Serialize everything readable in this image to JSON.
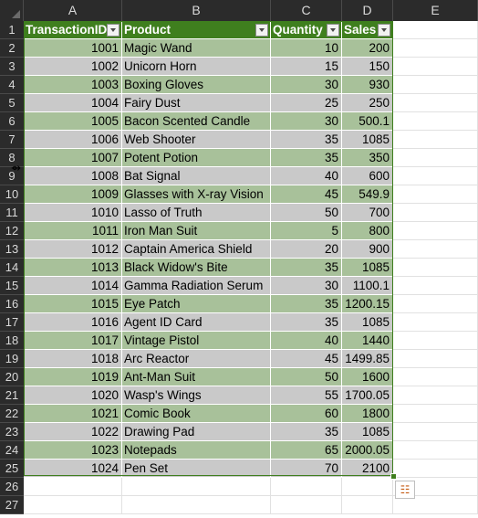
{
  "columns": [
    "A",
    "B",
    "C",
    "D",
    "E"
  ],
  "row_numbers": [
    "1",
    "2",
    "3",
    "4",
    "5",
    "6",
    "7",
    "8",
    "9",
    "10",
    "11",
    "12",
    "13",
    "14",
    "15",
    "16",
    "17",
    "18",
    "19",
    "20",
    "21",
    "22",
    "23",
    "24",
    "25",
    "26",
    "27"
  ],
  "table": {
    "headers": [
      "TransactionID",
      "Product",
      "Quantity",
      "Sales"
    ],
    "rows": [
      [
        "1001",
        "Magic Wand",
        "10",
        "200"
      ],
      [
        "1002",
        "Unicorn Horn",
        "15",
        "150"
      ],
      [
        "1003",
        "Boxing Gloves",
        "30",
        "930"
      ],
      [
        "1004",
        "Fairy Dust",
        "25",
        "250"
      ],
      [
        "1005",
        "Bacon Scented Candle",
        "30",
        "500.1"
      ],
      [
        "1006",
        "Web Shooter",
        "35",
        "1085"
      ],
      [
        "1007",
        "Potent Potion",
        "35",
        "350"
      ],
      [
        "1008",
        "Bat Signal",
        "40",
        "600"
      ],
      [
        "1009",
        "Glasses with X-ray Vision",
        "45",
        "549.9"
      ],
      [
        "1010",
        "Lasso of Truth",
        "50",
        "700"
      ],
      [
        "1011",
        "Iron Man Suit",
        "5",
        "800"
      ],
      [
        "1012",
        "Captain America Shield",
        "20",
        "900"
      ],
      [
        "1013",
        "Black Widow's Bite",
        "35",
        "1085"
      ],
      [
        "1014",
        "Gamma Radiation Serum",
        "30",
        "1100.1"
      ],
      [
        "1015",
        "Eye Patch",
        "35",
        "1200.15"
      ],
      [
        "1016",
        "Agent ID Card",
        "35",
        "1085"
      ],
      [
        "1017",
        "Vintage Pistol",
        "40",
        "1440"
      ],
      [
        "1018",
        "Arc Reactor",
        "45",
        "1499.85"
      ],
      [
        "1019",
        "Ant-Man Suit",
        "50",
        "1600"
      ],
      [
        "1020",
        "Wasp's Wings",
        "55",
        "1700.05"
      ],
      [
        "1021",
        "Comic Book",
        "60",
        "1800"
      ],
      [
        "1022",
        "Drawing Pad",
        "35",
        "1085"
      ],
      [
        "1023",
        "Notepads",
        "65",
        "2000.05"
      ],
      [
        "1024",
        "Pen Set",
        "70",
        "2100"
      ]
    ]
  },
  "icons": {
    "filter": "dropdown-arrow-icon",
    "quick_analysis": "quick-analysis-icon",
    "row_resize_cursor": "resize-cursor-icon"
  },
  "colors": {
    "header_fill": "#3f7f1e",
    "band_green": "#a8c19a",
    "band_gray": "#c9c9c9",
    "chrome_dark": "#2b2b2b"
  }
}
